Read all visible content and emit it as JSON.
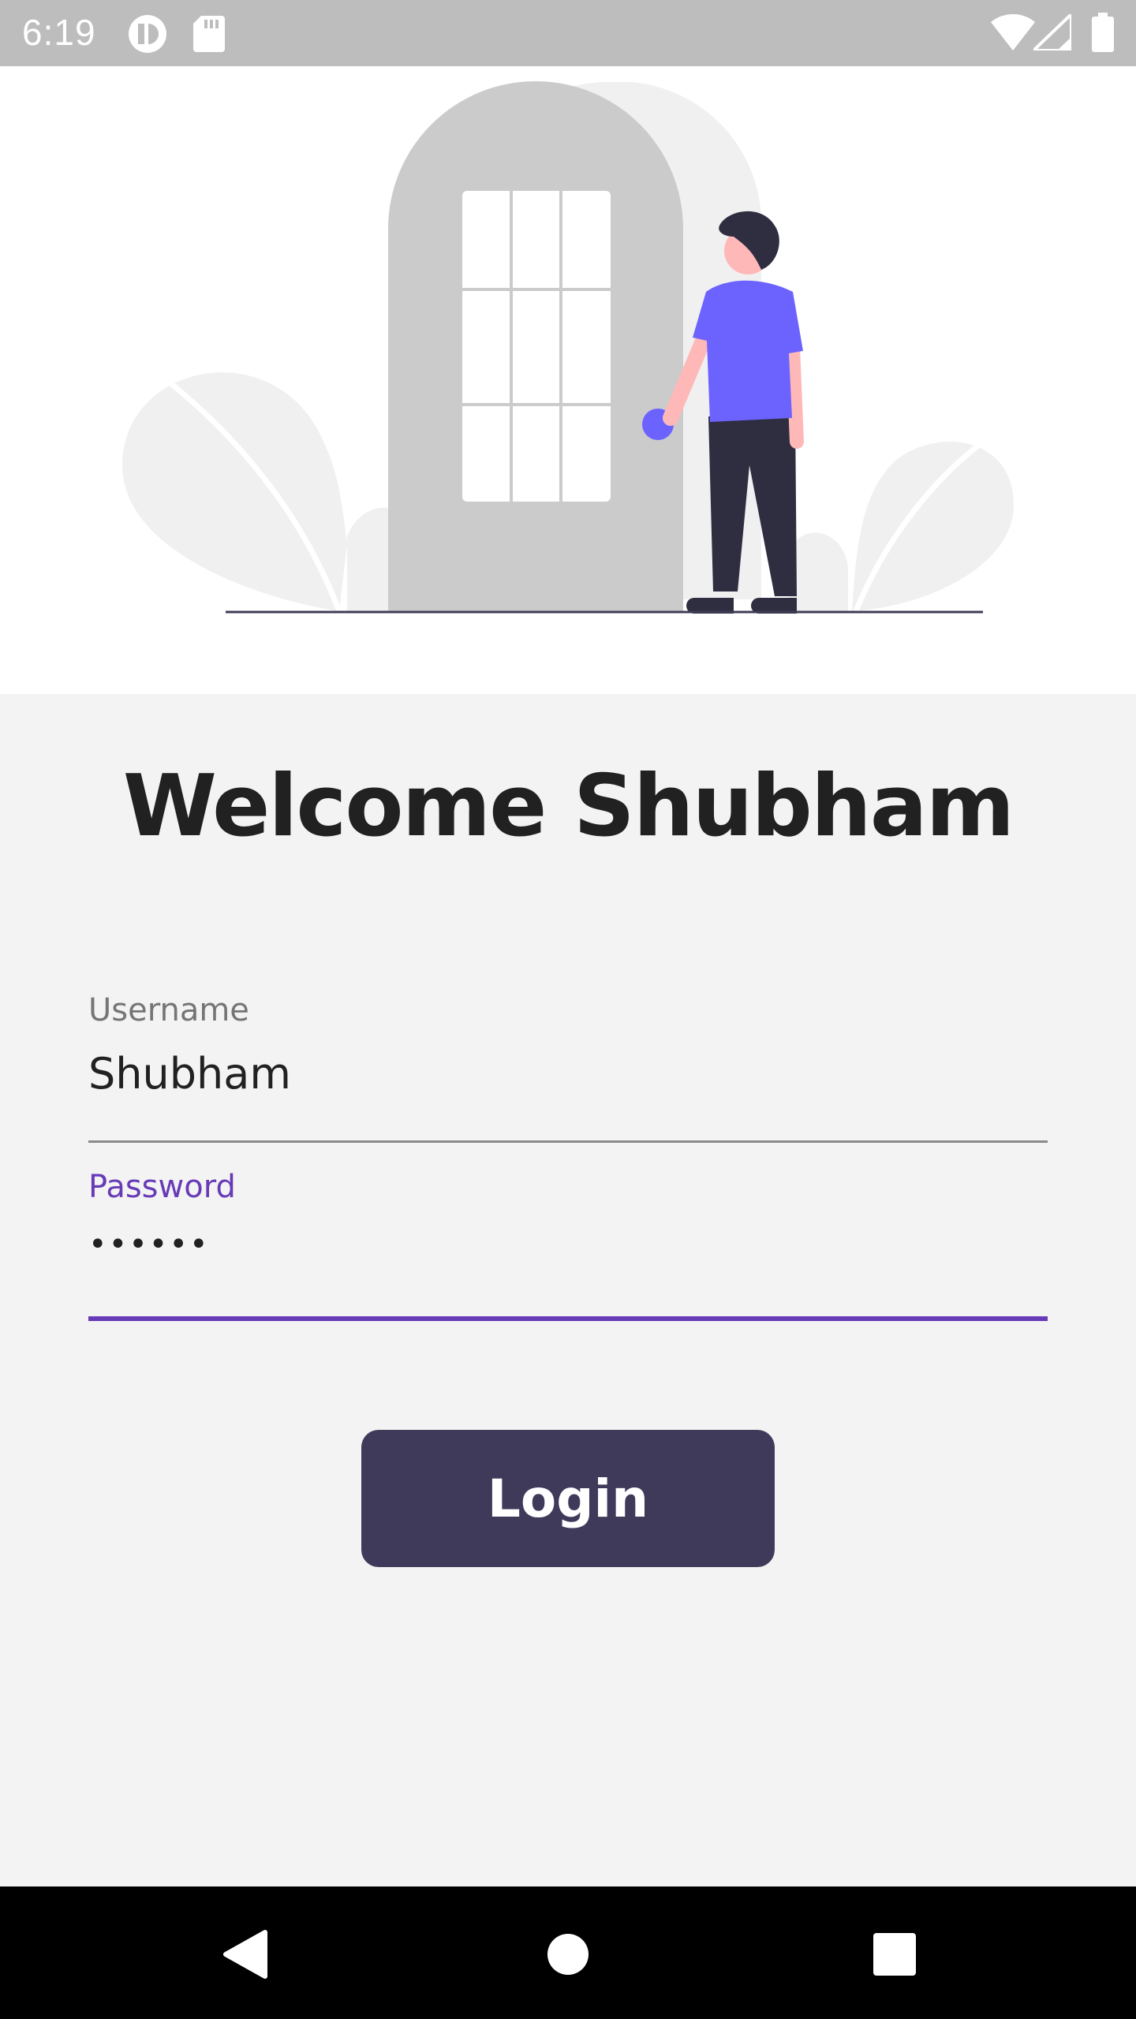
{
  "status_bar": {
    "time": "6:19",
    "icons": [
      "app-notification-icon",
      "sd-card-icon",
      "wifi-icon",
      "cell-signal-icon",
      "battery-icon"
    ]
  },
  "hero": {
    "illustration": "person-at-door-illustration",
    "colors": {
      "accent": "#6c63ff",
      "door": "#cbcbcb",
      "dark": "#2f2e41",
      "skin": "#ffb8b8"
    }
  },
  "welcome": {
    "title": "Welcome Shubham"
  },
  "username": {
    "label": "Username",
    "value": "Shubham"
  },
  "password": {
    "label": "Password",
    "value": "••••••"
  },
  "login": {
    "label": "Login"
  },
  "nav_bar": {
    "icons": [
      "back-icon",
      "home-icon",
      "recents-icon"
    ]
  },
  "colors": {
    "primary": "#673ab7",
    "button": "#403a5a",
    "background": "#f3f3f3",
    "status_bar": "#bdbdbd"
  }
}
